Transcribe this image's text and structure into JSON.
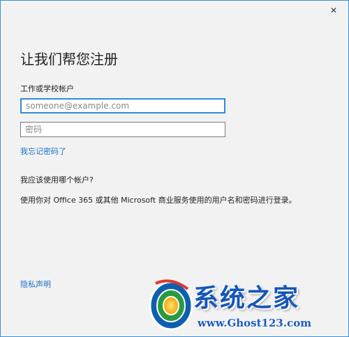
{
  "window": {
    "close_glyph": "✕"
  },
  "signin": {
    "title": "让我们帮您注册",
    "account_label": "工作或学校帐户",
    "email_placeholder": "someone@example.com",
    "email_value": "",
    "password_placeholder": "密码",
    "password_value": "",
    "forgot_link": "我忘记密码了",
    "which_account_heading": "我应该使用哪个帐户?",
    "description": "使用你对 Office 365 或其他 Microsoft 商业服务使用的用户名和密码进行登录。",
    "privacy_link": "隐私声明"
  },
  "watermark": {
    "brand": "系统之家",
    "url": "www.Ghost123.com"
  },
  "colors": {
    "accent": "#2e8bd8",
    "link": "#1a6fc4",
    "watermark_blue": "#1556b8"
  },
  "icons": {
    "close": "close-icon",
    "logo": "system-home-logo-icon"
  }
}
